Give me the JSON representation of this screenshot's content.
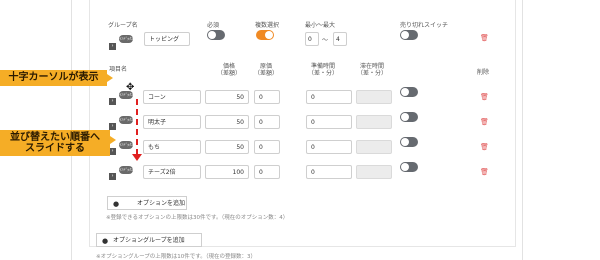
{
  "group": {
    "name_label": "グループ名",
    "badge": "ｲﾝﾃﾞｯｸｽ",
    "name_value": "トッピング",
    "required_label": "必須",
    "multi_label": "複数選択",
    "minmax_label": "最小〜最大",
    "min_value": "0",
    "tilde": "〜",
    "max_value": "4",
    "soldout_label": "売り切れスイッチ"
  },
  "columns": {
    "item_name": "項目名",
    "price": "価格\n（差額）",
    "cost": "原価\n（差額）",
    "prep_time": "準備時間\n（差・分）",
    "stay_time": "滞在時間\n（差・分）",
    "delete": "削除"
  },
  "rows": [
    {
      "name": "コーン",
      "price": "50",
      "cost": "0",
      "prep": "0"
    },
    {
      "name": "明太子",
      "price": "50",
      "cost": "0",
      "prep": "0"
    },
    {
      "name": "もち",
      "price": "50",
      "cost": "0",
      "prep": "0"
    },
    {
      "name": "チーズ2倍",
      "price": "100",
      "cost": "0",
      "prep": "0"
    }
  ],
  "add_option_label": "オプションを追加",
  "option_limit_note": "※登録できるオプションの上限数は30件です。（現在のオプション数：4）",
  "add_group_label": "オプショングループを追加",
  "group_limit_note": "※オプショングループの上限数は10件です。（現在の登録数：3）",
  "callouts": {
    "cross_cursor": "十字カーソルが表示",
    "drag_line1": "並び替えたい順番へ",
    "drag_line2": "スライドする"
  },
  "colors": {
    "accent": "#f08a24",
    "callout": "#f5ad26",
    "delete": "#e05050",
    "arrow": "#e02020"
  }
}
